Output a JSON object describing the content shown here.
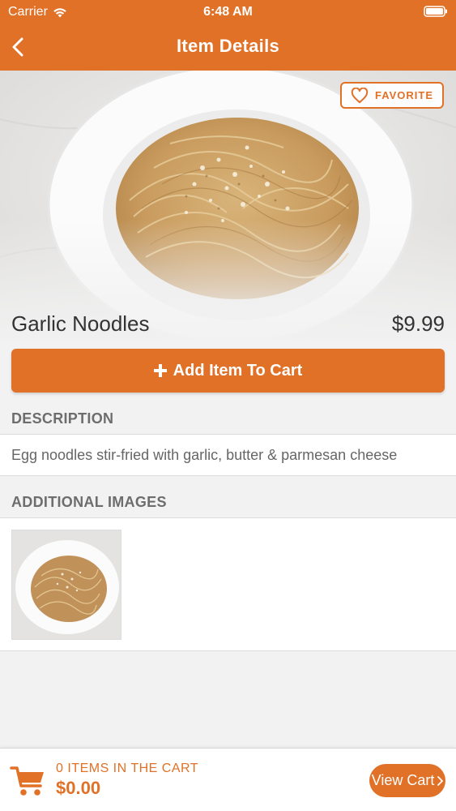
{
  "status_bar": {
    "carrier": "Carrier",
    "time": "6:48 AM",
    "wifi_icon": "wifi-icon",
    "battery_icon": "battery-icon"
  },
  "nav": {
    "title": "Item Details",
    "back_icon": "chevron-left-icon"
  },
  "item": {
    "name": "Garlic Noodles",
    "price": "$9.99",
    "favorite_label": "FAVORITE",
    "favorite_icon": "heart-icon",
    "add_to_cart_label": "Add Item To Cart",
    "add_icon": "plus-icon",
    "image": "garlic-noodles-photo"
  },
  "description": {
    "header": "DESCRIPTION",
    "text": "Egg noodles stir-fried with garlic, butter & parmesan cheese"
  },
  "additional_images": {
    "header": "ADDITIONAL IMAGES",
    "images": [
      "garlic-noodles-thumbnail"
    ]
  },
  "cart": {
    "count_label": "0 ITEMS IN THE CART",
    "total": "$0.00",
    "view_cart_label": "View Cart",
    "cart_icon": "shopping-cart-icon"
  },
  "colors": {
    "accent": "#e07127",
    "background": "#f2f2f2",
    "section_text": "#6d6d6d"
  }
}
